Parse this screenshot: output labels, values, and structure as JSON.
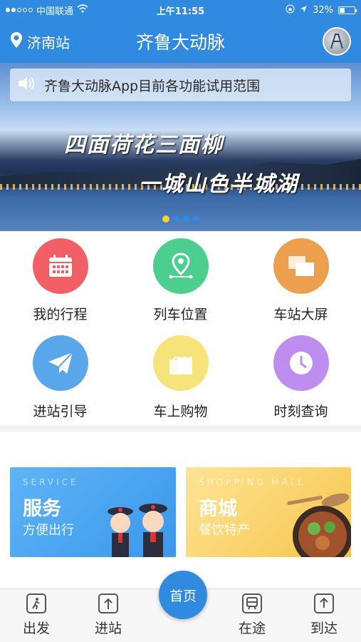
{
  "status_bar": {
    "carrier": "中国联通",
    "time": "上午11:55",
    "battery": "32%"
  },
  "nav": {
    "station": "济南站",
    "title": "齐鲁大动脉"
  },
  "banner": {
    "notice": "齐鲁大动脉App目前各功能试用范围",
    "calligraphy_line1": "四面荷花三面柳",
    "calligraphy_line2": "一城山色半城湖",
    "pages": 4,
    "active_page": 1
  },
  "features": [
    {
      "label": "我的行程",
      "icon": "calendar-icon",
      "color": "#f26065"
    },
    {
      "label": "列车位置",
      "icon": "location-pin-icon",
      "color": "#4ccf8e"
    },
    {
      "label": "车站大屏",
      "icon": "screens-icon",
      "color": "#eca04d"
    },
    {
      "label": "进站引导",
      "icon": "paper-plane-icon",
      "color": "#5aa6ea"
    },
    {
      "label": "车上购物",
      "icon": "shopping-bag-icon",
      "color": "#f6e37a"
    },
    {
      "label": "时刻查询",
      "icon": "clock-icon",
      "color": "#bd8ef0"
    }
  ],
  "cards": {
    "service": {
      "en": "SERVICE",
      "title": "服务",
      "subtitle": "方便出行"
    },
    "mall": {
      "en": "SHOPPING MALL",
      "title": "商城",
      "subtitle": "餐饮特产"
    }
  },
  "tabbar": {
    "depart": "出发",
    "enter": "进站",
    "home": "首页",
    "enroute": "在途",
    "arrive": "到达"
  }
}
